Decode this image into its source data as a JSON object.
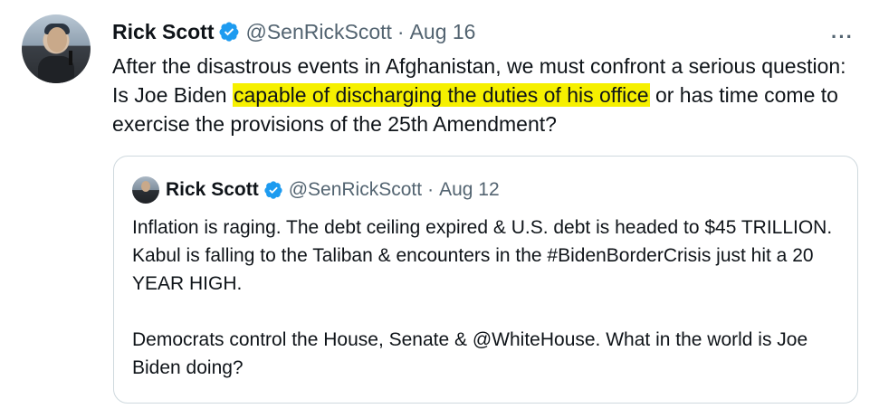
{
  "tweet": {
    "author_name": "Rick Scott",
    "handle": "@SenRickScott",
    "separator": "·",
    "date": "Aug 16",
    "more_label": "···",
    "text_before": "After the disastrous events in Afghanistan, we must confront a serious question: Is Joe Biden ",
    "text_highlight": "capable of discharging the duties of his office",
    "text_after": " or has time come to exercise the provisions of the 25th Amendment?",
    "icons": {
      "avatar": "profile-photo",
      "verified": "verified-badge-icon",
      "more": "more-options-icon"
    },
    "colors": {
      "verified": "#1d9bf0",
      "highlight": "#f6f000",
      "secondary_text": "#536471"
    }
  },
  "quoted_tweet": {
    "author_name": "Rick Scott",
    "handle": "@SenRickScott",
    "separator": "·",
    "date": "Aug 12",
    "paragraph_1": "Inflation is raging. The debt ceiling expired & U.S. debt is headed to $45 TRILLION. Kabul is falling to the Taliban & encounters in the #BidenBorderCrisis just hit a 20 YEAR HIGH.",
    "paragraph_2": "Democrats control the House, Senate & @WhiteHouse. What in the world is Joe Biden doing?"
  }
}
